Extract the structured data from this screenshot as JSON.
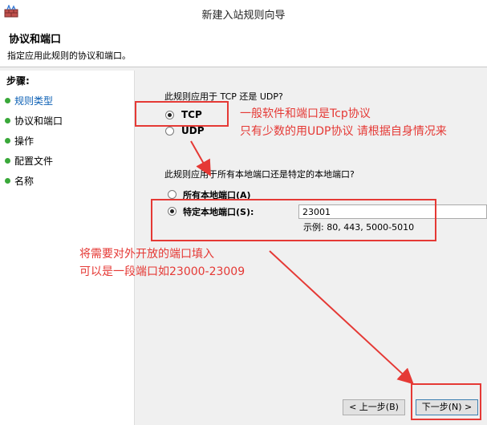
{
  "window": {
    "title": "新建入站规则向导"
  },
  "header": {
    "title": "协议和端口",
    "description": "指定应用此规则的协议和端口。"
  },
  "sidebar": {
    "title": "步骤:",
    "items": [
      {
        "label": "规则类型"
      },
      {
        "label": "协议和端口"
      },
      {
        "label": "操作"
      },
      {
        "label": "配置文件"
      },
      {
        "label": "名称"
      }
    ]
  },
  "main": {
    "protocol_question": "此规则应用于 TCP 还是 UDP?",
    "tcp_label": "TCP",
    "udp_label": "UDP",
    "ports_question": "此规则应用于所有本地端口还是特定的本地端口?",
    "all_ports_label": "所有本地端口(A)",
    "specific_ports_label": "特定本地端口(S):",
    "ports_value": "23001",
    "ports_example": "示例: 80, 443, 5000-5010"
  },
  "annotations": {
    "note1_line1": "一般软件和端口是Tcp协议",
    "note1_line2": "只有少数的用UDP协议 请根据自身情况来",
    "note2_line1": "将需要对外开放的端口填入",
    "note2_line2": "可以是一段端口如23000-23009"
  },
  "buttons": {
    "back": "< 上一步(B)",
    "next": "下一步(N) >"
  },
  "colors": {
    "annotation": "#e53935",
    "step_done": "#3aa83a",
    "step_current": "#0b5fb4"
  }
}
